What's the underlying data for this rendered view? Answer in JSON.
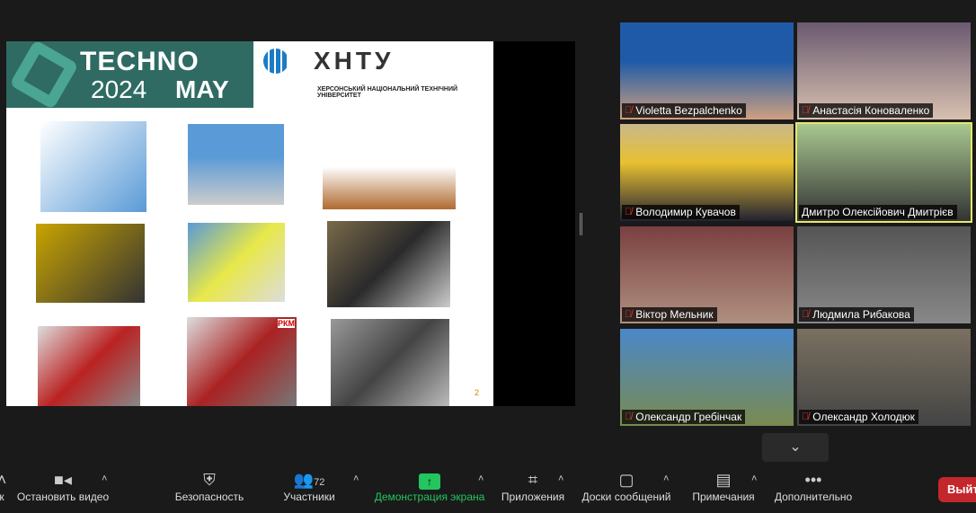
{
  "slide": {
    "banner_tech": "TECHNO",
    "banner_year": "2024",
    "banner_may": "MAY",
    "logo_text": "ХНТУ",
    "university": "ХЕРСОНСЬКИЙ НАЦІОНАЛЬНИЙ ТЕХНІЧНИЙ УНІВЕРСИТЕТ",
    "image_label": "РКМ",
    "page_number": "2"
  },
  "participants": [
    {
      "name": "Violetta Bezpalchenko",
      "muted": true
    },
    {
      "name": "Анастасія Коноваленко",
      "muted": true
    },
    {
      "name": "Володимир Кувачов",
      "muted": true
    },
    {
      "name": "Дмитро Олексійович Дмитрієв",
      "muted": false,
      "active": true
    },
    {
      "name": "Віктор Мельник",
      "muted": true
    },
    {
      "name": "Людмила Рибакова",
      "muted": true
    },
    {
      "name": "Олександр Гребінчак",
      "muted": true
    },
    {
      "name": "Олександр Холодюк",
      "muted": true
    }
  ],
  "toolbar": {
    "partial_left": "к",
    "video": "Остановить видео",
    "security": "Безопасность",
    "participants": "Участники",
    "participant_count": "72",
    "share": "Демонстрация экрана",
    "apps": "Приложения",
    "whiteboards": "Доски сообщений",
    "notes": "Примечания",
    "more": "Дополнительно",
    "leave": "Выйти"
  },
  "colors": {
    "share_green": "#22c55e",
    "leave_red": "#c4272b",
    "active_border": "#e6e86a"
  }
}
